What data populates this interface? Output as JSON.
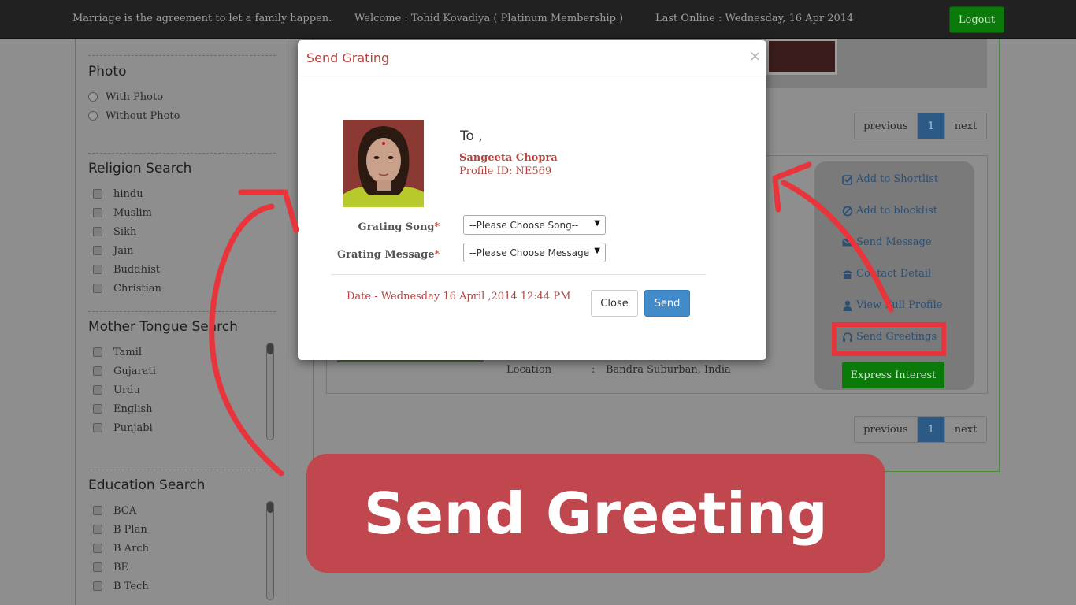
{
  "topbar": {
    "tagline": "Marriage is the agreement to let a family happen.",
    "welcome": "Welcome : Tohid Kovadiya ( Platinum Membership )",
    "last_online": "Last Online : Wednesday, 16 Apr 2014",
    "logout_label": "Logout"
  },
  "sidebar": {
    "photo": {
      "title": "Photo",
      "options": [
        "With Photo",
        "Without Photo"
      ]
    },
    "religion": {
      "title": "Religion Search",
      "options": [
        "hindu",
        "Muslim",
        "Sikh",
        "Jain",
        "Buddhist",
        "Christian"
      ]
    },
    "mother_tongue": {
      "title": "Mother Tongue Search",
      "options": [
        "Tamil",
        "Gujarati",
        "Urdu",
        "English",
        "Punjabi"
      ]
    },
    "education": {
      "title": "Education Search",
      "options": [
        "BCA",
        "B Plan",
        "B Arch",
        "BE",
        "B Tech"
      ]
    }
  },
  "pagination": {
    "previous": "previous",
    "page": "1",
    "next": "next"
  },
  "profile": {
    "location_label": "Location",
    "location_sep": ":",
    "location_value": "Bandra Suburban, India",
    "actions": [
      {
        "label": "Add to Shortlist",
        "icon": "check-square-icon"
      },
      {
        "label": "Add to blocklist",
        "icon": "ban-icon"
      },
      {
        "label": "Send Message",
        "icon": "envelope-icon"
      },
      {
        "label": "Contact Detail",
        "icon": "phone-icon"
      },
      {
        "label": "View Full Profile",
        "icon": "user-icon"
      },
      {
        "label": "Send Greetings",
        "icon": "headphones-icon"
      }
    ],
    "express_interest": "Express Interest"
  },
  "modal": {
    "title": "Send Grating",
    "close_symbol": "×",
    "to_label": "To ,",
    "recipient_name": "Sangeeta Chopra",
    "profile_id": "Profile ID: NE569",
    "song_label": "Grating Song",
    "song_placeholder": "--Please Choose Song--",
    "message_label": "Grating Message",
    "message_placeholder": "--Please Choose Message",
    "required_mark": "*",
    "date_text": "Date - Wednesday 16 April ,2014 12:44 PM",
    "close_button": "Close",
    "send_button": "Send"
  },
  "annotation": {
    "caption": "Send Greeting",
    "accent_color": "#e8343a",
    "banner_color": "#c0474d"
  }
}
